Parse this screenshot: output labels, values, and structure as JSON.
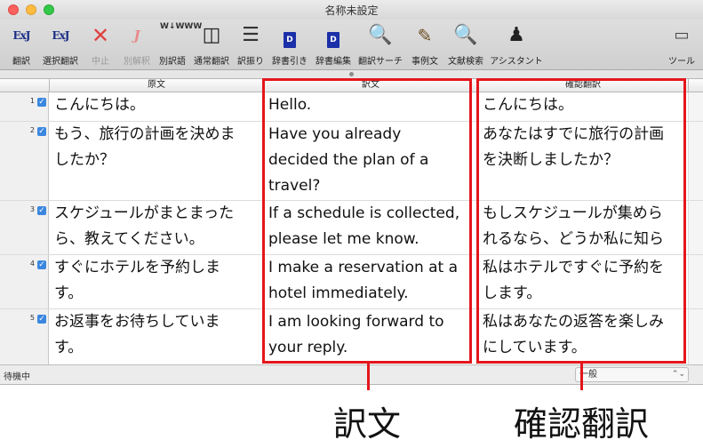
{
  "window": {
    "title": "名称未設定"
  },
  "toolbar": {
    "items": [
      {
        "label": "翻訳",
        "icon": "ExJ",
        "enabled": true
      },
      {
        "label": "選択翻訳",
        "icon": "ExJ",
        "enabled": true
      },
      {
        "label": "中止",
        "icon": "✕",
        "enabled": false
      },
      {
        "label": "別解釈",
        "icon": "J",
        "enabled": false
      },
      {
        "label": "別訳語",
        "icon": "W↓WWW",
        "enabled": true
      },
      {
        "label": "通常翻訳",
        "icon": "◫",
        "enabled": true
      },
      {
        "label": "訳振り",
        "icon": "☰",
        "enabled": true
      },
      {
        "label": "辞書引き",
        "icon": "D",
        "enabled": true
      },
      {
        "label": "辞書編集",
        "icon": "D",
        "enabled": true
      },
      {
        "label": "翻訳サーチ",
        "icon": "🔍",
        "enabled": true
      },
      {
        "label": "事例文",
        "icon": "✎",
        "enabled": true
      },
      {
        "label": "文献検索",
        "icon": "🔍",
        "enabled": true
      },
      {
        "label": "アシスタント",
        "icon": "♟",
        "enabled": true
      }
    ],
    "tool_label": "ツール",
    "tool_icon": "▭"
  },
  "table": {
    "headers": [
      "原文",
      "訳文",
      "確認翻訳"
    ],
    "rows": [
      {
        "num": "1",
        "source": "こんにちは。",
        "translation": "Hello.",
        "back": "こんにちは。"
      },
      {
        "num": "2",
        "source": "もう、旅行の計画を決めま\nしたか？",
        "translation": "Have you already\ndecided the plan of a\ntravel?",
        "back": "あなたはすでに旅行の計画\nを決断しましたか？"
      },
      {
        "num": "3",
        "source": "スケジュールがまとまった\nら、教えてください。",
        "translation": "If a schedule is collected,\nplease let me know.",
        "back": "もしスケジュールが集めら\nれるなら、どうか私に知ら"
      },
      {
        "num": "4",
        "source": "すぐにホテルを予約しま\nす。",
        "translation": "I make a reservation at a\nhotel immediately.",
        "back": "私はホテルですぐに予約を\nします。"
      },
      {
        "num": "5",
        "source": "お返事をお待ちしていま\nす。",
        "translation": "I am looking forward to\nyour reply.",
        "back": "私はあなたの返答を楽しみ\nにしています。"
      }
    ]
  },
  "status": {
    "text": "待機中",
    "mode": "一般",
    "mode_arrow": "⌃⌄"
  },
  "callouts": {
    "translation": "訳文",
    "back_translation": "確認翻訳"
  },
  "colors": {
    "highlight": "#e4161c",
    "check": "#3b87e0"
  }
}
